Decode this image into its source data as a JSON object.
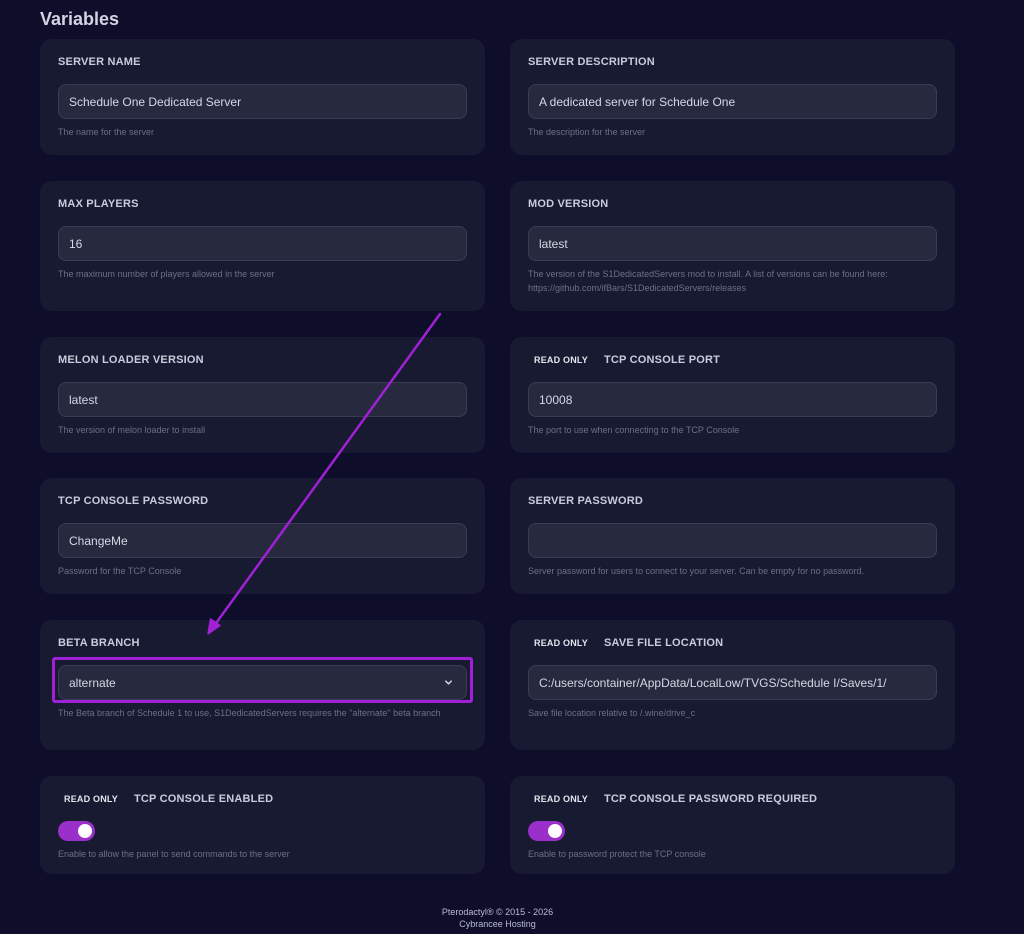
{
  "page": {
    "title": "Variables"
  },
  "variables": [
    {
      "title": "SERVER NAME",
      "value": "Schedule One Dedicated Server",
      "help": "The name for the server"
    },
    {
      "title": "SERVER DESCRIPTION",
      "value": "A dedicated server for Schedule One",
      "help": "The description for the server"
    },
    {
      "title": "MAX PLAYERS",
      "value": "16",
      "help": "The maximum number of players allowed in the server"
    },
    {
      "title": "MOD VERSION",
      "value": "latest",
      "help": "The version of the S1DedicatedServers mod to install. A list of versions can be found here: https://github.com/ifBars/S1DedicatedServers/releases"
    },
    {
      "title": "MELON LOADER VERSION",
      "value": "latest",
      "help": "The version of melon loader to install"
    },
    {
      "badge": "READ ONLY",
      "title": "TCP CONSOLE PORT",
      "value": "10008",
      "help": "The port to use when connecting to the TCP Console"
    },
    {
      "title": "TCP CONSOLE PASSWORD",
      "value": "ChangeMe",
      "help": "Password for the TCP Console"
    },
    {
      "title": "SERVER PASSWORD",
      "value": "",
      "help": "Server password for users to connect to your server. Can be empty for no password."
    },
    {
      "title": "BETA BRANCH",
      "value": "alternate",
      "help": "The Beta branch of Schedule 1 to use, S1DedicatedServers requires the \"alternate\" beta branch"
    },
    {
      "badge": "READ ONLY",
      "title": "SAVE FILE LOCATION",
      "value": "C:/users/container/AppData/LocalLow/TVGS/Schedule I/Saves/1/",
      "help": "Save file location relative to /.wine/drive_c"
    },
    {
      "badge": "READ ONLY",
      "title": "TCP CONSOLE ENABLED",
      "enabled": true,
      "help": "Enable to allow the panel to send commands to the server"
    },
    {
      "badge": "READ ONLY",
      "title": "TCP CONSOLE PASSWORD REQUIRED",
      "enabled": true,
      "help": "Enable to password protect the TCP console"
    }
  ],
  "footer": {
    "line1": "Pterodactyl® © 2015 - 2026",
    "line2": "Cybrancee Hosting"
  },
  "colors": {
    "background": "#0e0e2a",
    "card": "#181a32",
    "accent": "#a020d6",
    "toggle_on": "#9a2fc9"
  },
  "icons": {
    "select_chevron": "chevron-down-icon"
  }
}
